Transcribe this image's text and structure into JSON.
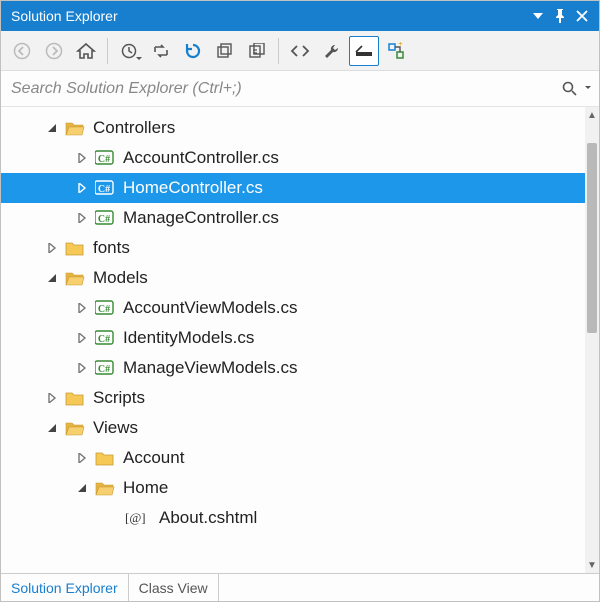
{
  "window": {
    "title": "Solution Explorer"
  },
  "search": {
    "placeholder": "Search Solution Explorer (Ctrl+;)"
  },
  "tree": [
    {
      "depth": 0,
      "exp": "expanded",
      "icon": "folder-open",
      "label": "Controllers",
      "selected": false
    },
    {
      "depth": 1,
      "exp": "collapsed",
      "icon": "cs",
      "label": "AccountController.cs",
      "selected": false
    },
    {
      "depth": 1,
      "exp": "collapsed",
      "icon": "cs",
      "label": "HomeController.cs",
      "selected": true
    },
    {
      "depth": 1,
      "exp": "collapsed",
      "icon": "cs",
      "label": "ManageController.cs",
      "selected": false
    },
    {
      "depth": 0,
      "exp": "collapsed",
      "icon": "folder",
      "label": "fonts",
      "selected": false
    },
    {
      "depth": 0,
      "exp": "expanded",
      "icon": "folder-open",
      "label": "Models",
      "selected": false
    },
    {
      "depth": 1,
      "exp": "collapsed",
      "icon": "cs",
      "label": "AccountViewModels.cs",
      "selected": false
    },
    {
      "depth": 1,
      "exp": "collapsed",
      "icon": "cs",
      "label": "IdentityModels.cs",
      "selected": false
    },
    {
      "depth": 1,
      "exp": "collapsed",
      "icon": "cs",
      "label": "ManageViewModels.cs",
      "selected": false
    },
    {
      "depth": 0,
      "exp": "collapsed",
      "icon": "folder",
      "label": "Scripts",
      "selected": false
    },
    {
      "depth": 0,
      "exp": "expanded",
      "icon": "folder-open",
      "label": "Views",
      "selected": false
    },
    {
      "depth": 1,
      "exp": "collapsed",
      "icon": "folder",
      "label": "Account",
      "selected": false
    },
    {
      "depth": 1,
      "exp": "expanded",
      "icon": "folder-open",
      "label": "Home",
      "selected": false
    },
    {
      "depth": 2,
      "exp": "none",
      "icon": "cshtml",
      "label": "About.cshtml",
      "selected": false
    }
  ],
  "tabs": {
    "items": [
      {
        "label": "Solution Explorer",
        "active": true
      },
      {
        "label": "Class View",
        "active": false
      }
    ]
  },
  "colors": {
    "accent": "#187fcf",
    "selection": "#1c97ea",
    "cs_green": "#388a34"
  }
}
